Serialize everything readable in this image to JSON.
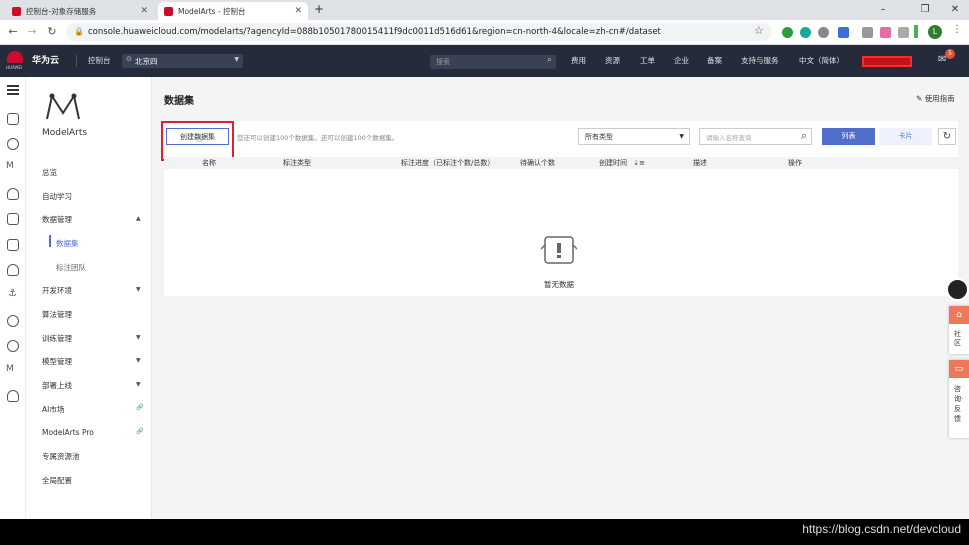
{
  "browser": {
    "tabs": [
      {
        "title": "控制台-对象存储服务",
        "active": false
      },
      {
        "title": "ModelArts - 控制台",
        "active": true
      }
    ],
    "new_tab": "+",
    "url": "console.huaweicloud.com/modelarts/?agencyId=088b10501780015411f9dc0011d516d61&region=cn-north-4&locale=zh-cn#/dataset",
    "profile_initial": "L"
  },
  "topnav": {
    "brand_text": "华为云",
    "brand_sub": "HUAWEI",
    "console": "控制台",
    "region": "北京四",
    "search_placeholder": "搜索",
    "links": [
      "费用",
      "资源",
      "工单",
      "企业",
      "备案",
      "支持与服务",
      "中文（简体）"
    ],
    "mail_badge": "5"
  },
  "sidebar": {
    "product": "ModelArts",
    "items": [
      {
        "label": "总览"
      },
      {
        "label": "自动学习"
      },
      {
        "label": "数据管理",
        "arrow": "▲"
      },
      {
        "label": "数据集",
        "sub": true,
        "active": true
      },
      {
        "label": "标注团队",
        "sub": true
      },
      {
        "label": "开发环境",
        "arrow": "▼"
      },
      {
        "label": "算法管理"
      },
      {
        "label": "训练管理",
        "arrow": "▼"
      },
      {
        "label": "模型管理",
        "arrow": "▼"
      },
      {
        "label": "部署上线",
        "arrow": "▼"
      },
      {
        "label": "AI市场",
        "arrow": "🔗"
      },
      {
        "label": "ModelArts Pro",
        "arrow": "🔗"
      },
      {
        "label": "专属资源池"
      },
      {
        "label": "全局配置"
      }
    ]
  },
  "main": {
    "title": "数据集",
    "guide": "使用指南",
    "create_button": "创建数据集",
    "hint": "您还可以创建100个数据集，还可以创建100个数据集。",
    "filter_select": "所有类型",
    "search_placeholder": "请输入名称查询",
    "view_list": "列表",
    "view_card": "卡片",
    "columns": [
      "名称",
      "标注类型",
      "标注进度（已标注个数/总数）",
      "待确认个数",
      "创建时间",
      "描述",
      "操作"
    ],
    "empty_text": "暂无数据"
  },
  "float_tools": {
    "community": "社区",
    "feedback": "咨询·反馈"
  },
  "watermark": "https://blog.csdn.net/devcloud",
  "colors": {
    "topnav": "#252b3a",
    "primary": "#526ecc",
    "highlight": "#e0202d"
  }
}
